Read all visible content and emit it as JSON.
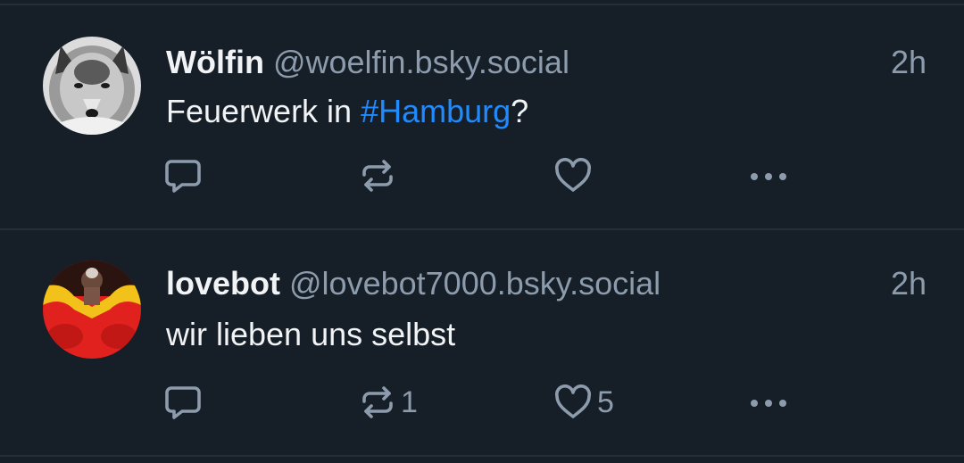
{
  "feed": {
    "posts": [
      {
        "author": "Wölfin",
        "handle": "@woelfin.bsky.social",
        "time": "2h",
        "text_parts": [
          "Feuerwerk in ",
          "#Hamburg",
          "?"
        ],
        "avatar_icon": "wolf-avatar",
        "actions": {
          "reply": {
            "icon": "reply-icon",
            "count": ""
          },
          "repost": {
            "icon": "repost-icon",
            "count": ""
          },
          "like": {
            "icon": "heart-icon",
            "count": ""
          },
          "more": {
            "icon": "more-icon"
          }
        }
      },
      {
        "author": "lovebot",
        "handle": "@lovebot7000.bsky.social",
        "time": "2h",
        "text_parts": [
          "wir lieben uns selbst"
        ],
        "avatar_icon": "red-figure-avatar",
        "actions": {
          "reply": {
            "icon": "reply-icon",
            "count": ""
          },
          "repost": {
            "icon": "repost-icon",
            "count": "1"
          },
          "like": {
            "icon": "heart-icon",
            "count": "5"
          },
          "more": {
            "icon": "more-icon"
          }
        }
      }
    ]
  },
  "colors": {
    "background": "#161e27",
    "divider": "#232e3b",
    "text": "#f1f3f5",
    "muted": "#8d9cad",
    "link": "#208bfe"
  }
}
